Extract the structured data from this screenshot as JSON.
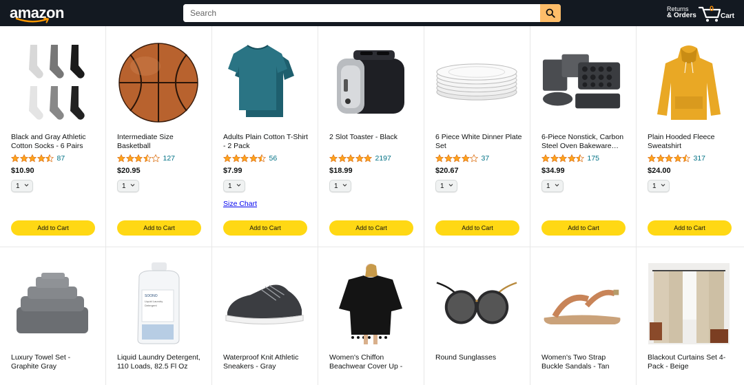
{
  "header": {
    "logo": "amazon",
    "search_placeholder": "Search",
    "returns_line1": "Returns",
    "returns_line2": "& Orders",
    "cart_count": "0",
    "cart_label": "Cart"
  },
  "products": [
    {
      "title": "Black and Gray Athletic Cotton Socks - 6 Pairs",
      "rating": 4.5,
      "count": "87",
      "price": "$10.90",
      "qty": "1",
      "add": "Add to Cart"
    },
    {
      "title": "Intermediate Size Basketball",
      "rating": 3.5,
      "count": "127",
      "price": "$20.95",
      "qty": "1",
      "add": "Add to Cart"
    },
    {
      "title": "Adults Plain Cotton T-Shirt - 2 Pack",
      "rating": 4.5,
      "count": "56",
      "price": "$7.99",
      "qty": "1",
      "size_chart": "Size Chart",
      "add": "Add to Cart"
    },
    {
      "title": "2 Slot Toaster - Black",
      "rating": 5,
      "count": "2197",
      "price": "$18.99",
      "qty": "1",
      "add": "Add to Cart"
    },
    {
      "title": "6 Piece White Dinner Plate Set",
      "rating": 4,
      "count": "37",
      "price": "$20.67",
      "qty": "1",
      "add": "Add to Cart"
    },
    {
      "title": "6-Piece Nonstick, Carbon Steel Oven Bakeware…",
      "rating": 4.5,
      "count": "175",
      "price": "$34.99",
      "qty": "1",
      "add": "Add to Cart"
    },
    {
      "title": "Plain Hooded Fleece Sweatshirt",
      "rating": 4.5,
      "count": "317",
      "price": "$24.00",
      "qty": "1",
      "add": "Add to Cart"
    }
  ],
  "products_row2": [
    {
      "title": "Luxury Towel Set - Graphite Gray"
    },
    {
      "title": "Liquid Laundry Detergent, 110 Loads, 82.5 Fl Oz"
    },
    {
      "title": "Waterproof Knit Athletic Sneakers - Gray"
    },
    {
      "title": "Women's Chiffon Beachwear Cover Up -"
    },
    {
      "title": "Round Sunglasses"
    },
    {
      "title": "Women's Two Strap Buckle Sandals - Tan"
    },
    {
      "title": "Blackout Curtains Set 4-Pack - Beige"
    }
  ],
  "colors": {
    "header_bg": "#131921",
    "search_button": "#febd69",
    "add_button": "#ffd814",
    "star": "#ffa41c",
    "rating_count": "#007185",
    "cart_count": "#f08804"
  },
  "detergent_label": [
    "SOONO",
    "Liquid Laundry",
    "Detergent"
  ]
}
